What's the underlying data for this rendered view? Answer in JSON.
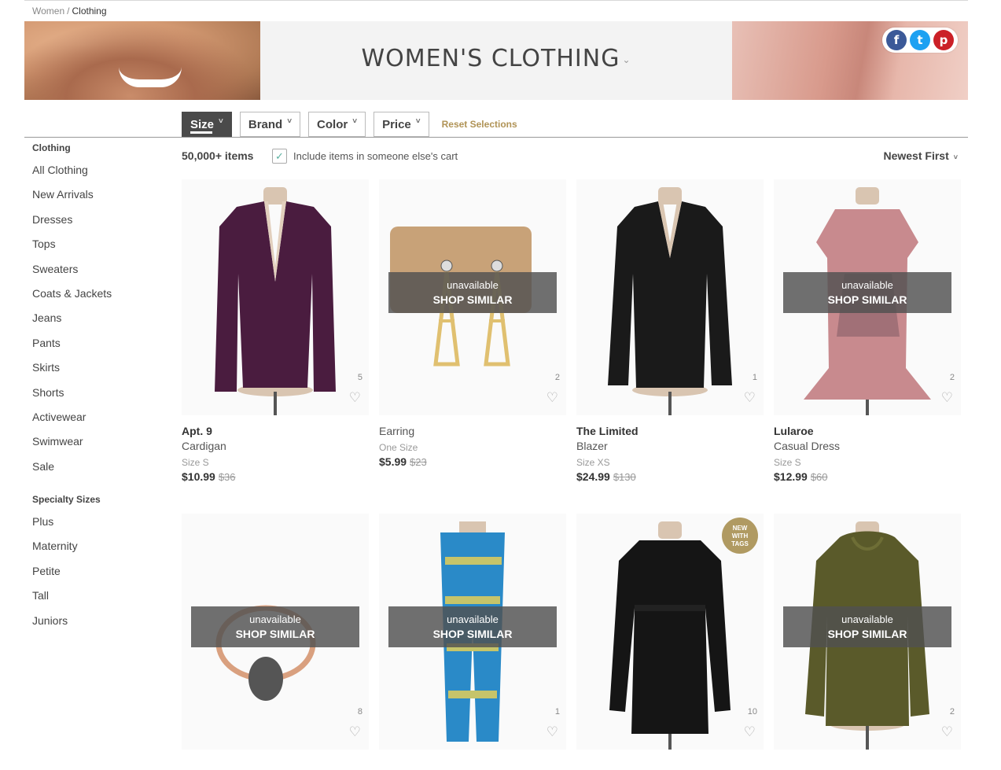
{
  "breadcrumb": {
    "parent": "Women",
    "separator": "/",
    "current": "Clothing"
  },
  "hero": {
    "title": "WOMEN'S CLOTHING",
    "title_caret": "⌄"
  },
  "social": {
    "facebook": "f",
    "twitter": "t",
    "pinterest": "p"
  },
  "filters": {
    "size": "Size",
    "brand": "Brand",
    "color": "Color",
    "price": "Price",
    "chevron": "˅",
    "reset": "Reset Selections"
  },
  "sidebar": {
    "clothing_heading": "Clothing",
    "clothing_items": [
      "All Clothing",
      "New Arrivals",
      "Dresses",
      "Tops",
      "Sweaters",
      "Coats & Jackets",
      "Jeans",
      "Pants",
      "Skirts",
      "Shorts",
      "Activewear",
      "Swimwear",
      "Sale"
    ],
    "specialty_heading": "Specialty Sizes",
    "specialty_items": [
      "Plus",
      "Maternity",
      "Petite",
      "Tall",
      "Juniors"
    ]
  },
  "results": {
    "count": "50,000+ items",
    "include_cart_label": "Include items in someone else's cart",
    "include_cart_checked": true,
    "check_glyph": "✓",
    "sort_label": "Newest First",
    "sort_chevron": "˅"
  },
  "overlay": {
    "line1": "unavailable",
    "line2": "SHOP SIMILAR"
  },
  "heart_glyph": "♡",
  "nwt_badge": [
    "NEW",
    "WITH",
    "TAGS"
  ],
  "products": [
    {
      "brand": "Apt. 9",
      "category": "Cardigan",
      "size": "Size S",
      "price": "$10.99",
      "original": "$36",
      "count": "5",
      "unavailable": false,
      "colors": [
        "#4a1c3f",
        "#3a1432"
      ]
    },
    {
      "brand": "",
      "category": "Earring",
      "size": "One Size",
      "price": "$5.99",
      "original": "$23",
      "count": "2",
      "unavailable": true,
      "colors": [
        "#c8a070",
        "#e0c070"
      ]
    },
    {
      "brand": "The Limited",
      "category": "Blazer",
      "size": "Size XS",
      "price": "$24.99",
      "original": "$130",
      "count": "1",
      "unavailable": false,
      "colors": [
        "#1a1a1a",
        "#0e0e0e"
      ]
    },
    {
      "brand": "Lularoe",
      "category": "Casual Dress",
      "size": "Size S",
      "price": "$12.99",
      "original": "$60",
      "count": "2",
      "unavailable": true,
      "colors": [
        "#c88a8e",
        "#7a5560"
      ]
    },
    {
      "count": "8",
      "unavailable": true,
      "colors": [
        "#d9a07f",
        "#555"
      ]
    },
    {
      "count": "1",
      "unavailable": true,
      "colors": [
        "#2a8ac8",
        "#c6c46a"
      ]
    },
    {
      "count": "10",
      "unavailable": false,
      "nwt": true,
      "colors": [
        "#151515",
        "#222"
      ]
    },
    {
      "count": "2",
      "unavailable": true,
      "colors": [
        "#5a5a2a",
        "#6e6e36"
      ]
    }
  ]
}
